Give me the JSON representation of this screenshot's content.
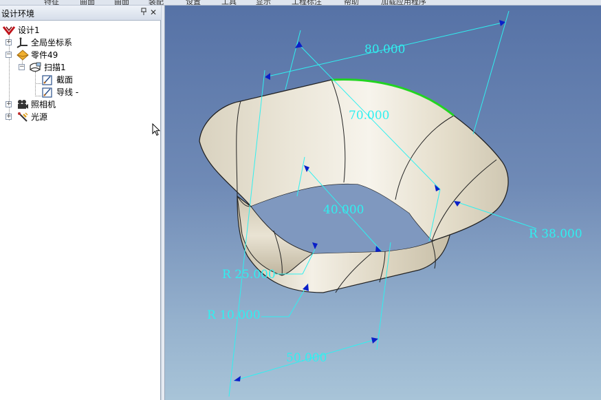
{
  "menubar": {
    "items": [
      "特征",
      "曲面",
      "曲面",
      "装配",
      "设置",
      "工具",
      "显示",
      "工程标注",
      "帮助",
      "加载应用程序"
    ]
  },
  "panel": {
    "title": "设计环境",
    "pin": "ᵖ",
    "close": "✕",
    "tree": {
      "root": "设计1",
      "global_coords": "全局坐标系",
      "part": "零件49",
      "sweep": "扫描1",
      "section": "截面",
      "guide": "导线 -",
      "camera": "照相机",
      "light": "光源"
    }
  },
  "viewport": {
    "dims": {
      "d80": "80.000",
      "d70": "70.000",
      "d40": "40.000",
      "r38": "R 38.000",
      "r25": "R 25.000",
      "r10": "R 10.000",
      "d50": "50.000"
    },
    "colors": {
      "dimension": "#2ff0f0",
      "highlight_edge": "#22d422",
      "surface": "#e9e4d6"
    }
  }
}
